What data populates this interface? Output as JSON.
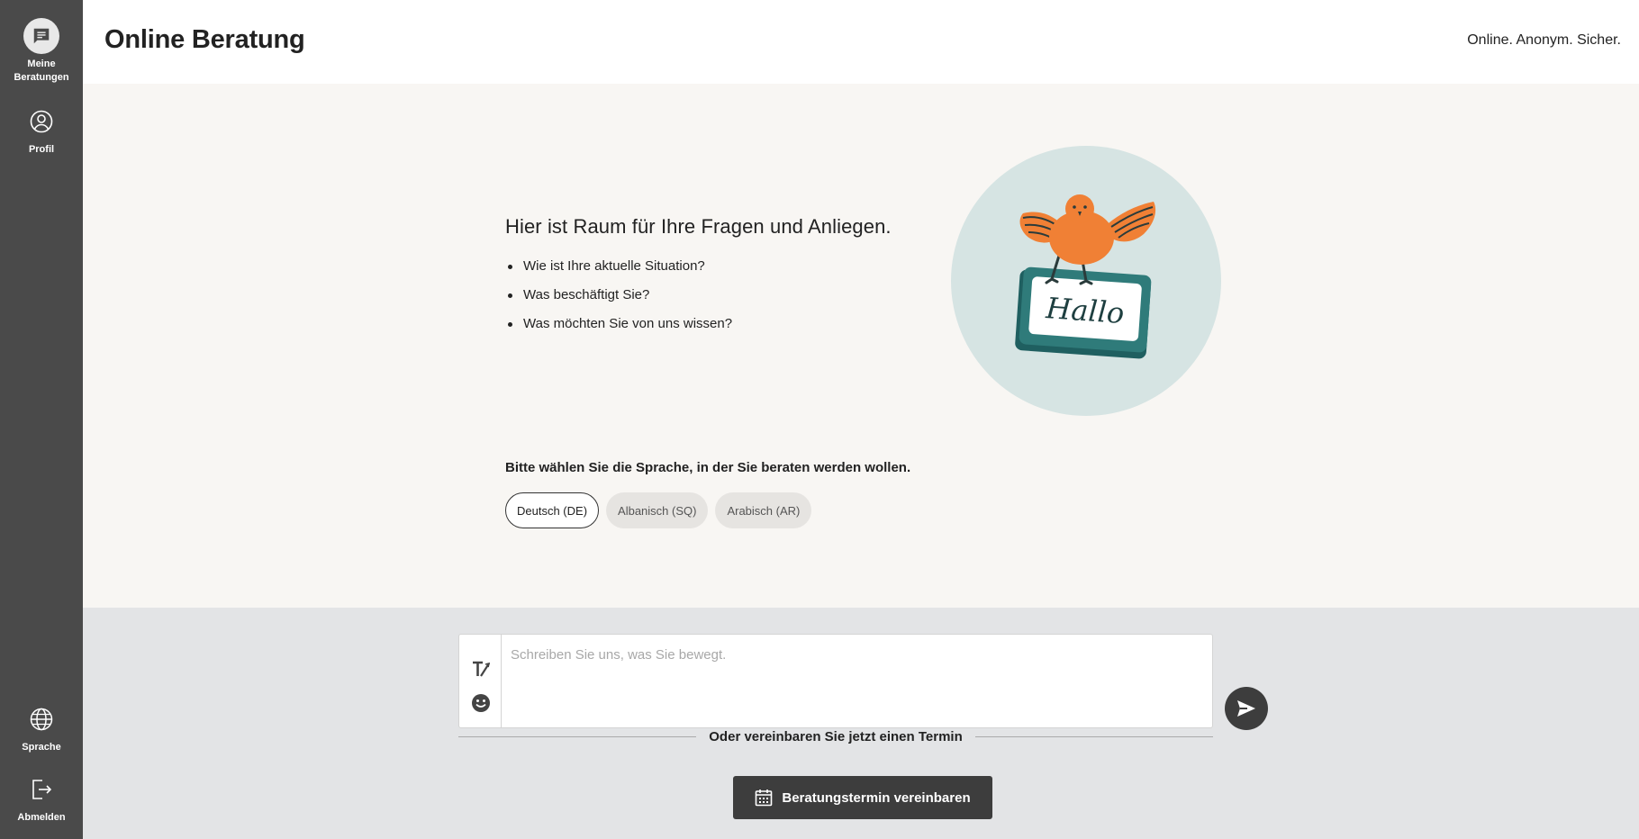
{
  "sidebar": {
    "items": [
      {
        "label": "Meine Beratungen",
        "icon": "chat-bubble-icon",
        "active": true
      },
      {
        "label": "Profil",
        "icon": "user-circle-icon",
        "active": false
      }
    ],
    "bottom_items": [
      {
        "label": "Sprache",
        "icon": "globe-icon"
      },
      {
        "label": "Abmelden",
        "icon": "logout-icon"
      }
    ]
  },
  "header": {
    "title": "Online Beratung",
    "tagline": "Online. Anonym. Sicher."
  },
  "welcome": {
    "title": "Hier ist Raum für Ihre Fragen und Anliegen.",
    "questions": [
      "Wie ist Ihre aktuelle Situation?",
      "Was beschäftigt Sie?",
      "Was möchten Sie von uns wissen?"
    ],
    "illustration_sign_text": "Hallo"
  },
  "language": {
    "prompt": "Bitte wählen Sie die Sprache, in der Sie beraten werden wollen.",
    "options": [
      {
        "label": "Deutsch (DE)",
        "selected": true
      },
      {
        "label": "Albanisch (SQ)",
        "selected": false
      },
      {
        "label": "Arabisch (AR)",
        "selected": false
      }
    ]
  },
  "composer": {
    "placeholder": "Schreiben Sie uns, was Sie bewegt.",
    "value": "",
    "divider_text": "Oder vereinbaren Sie jetzt einen Termin",
    "appointment_label": "Beratungstermin vereinbaren"
  },
  "colors": {
    "sidebar": "#4a4a4a",
    "main_bg": "#f8f6f3",
    "composer_bg": "#e3e4e6",
    "bird": "#f08035",
    "sign": "#2f7b7a",
    "circle": "#d6e4e3"
  }
}
